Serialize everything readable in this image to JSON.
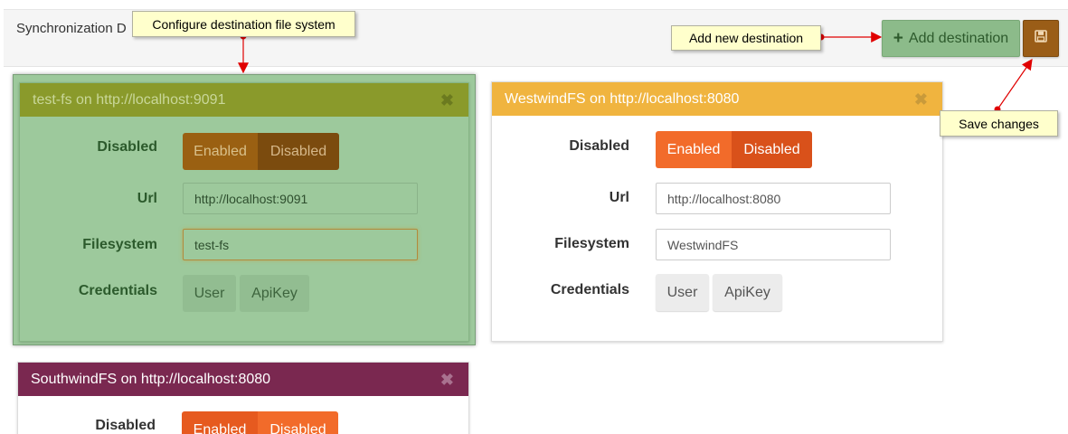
{
  "header": {
    "title": "Synchronization D",
    "add_label": "Add destination",
    "colors": {
      "add_bg": "#8cbb8a",
      "save_bg": "#9a5d17"
    }
  },
  "cards": {
    "testfs": {
      "title": "test-fs on http://localhost:9091",
      "disabled_label": "Disabled",
      "toggle_enabled": "Enabled",
      "toggle_disabled": "Disabled",
      "url_label": "Url",
      "url_value": "http://localhost:9091",
      "fs_label": "Filesystem",
      "fs_value": "test-fs",
      "cred_label": "Credentials",
      "cred_user": "User",
      "cred_apikey": "ApiKey",
      "color": "#8a9a2b"
    },
    "westwind": {
      "title": "WestwindFS on http://localhost:8080",
      "disabled_label": "Disabled",
      "toggle_enabled": "Enabled",
      "toggle_disabled": "Disabled",
      "url_label": "Url",
      "url_value": "http://localhost:8080",
      "fs_label": "Filesystem",
      "fs_value": "WestwindFS",
      "cred_label": "Credentials",
      "cred_user": "User",
      "cred_apikey": "ApiKey",
      "color": "#f0b43f"
    },
    "southwind": {
      "title": "SouthwindFS on http://localhost:8080",
      "disabled_label": "Disabled",
      "toggle_enabled": "Enabled",
      "toggle_disabled": "Disabled",
      "color": "#7a2850"
    }
  },
  "callouts": {
    "configure": "Configure destination file system",
    "add": "Add new destination",
    "save": "Save changes"
  }
}
